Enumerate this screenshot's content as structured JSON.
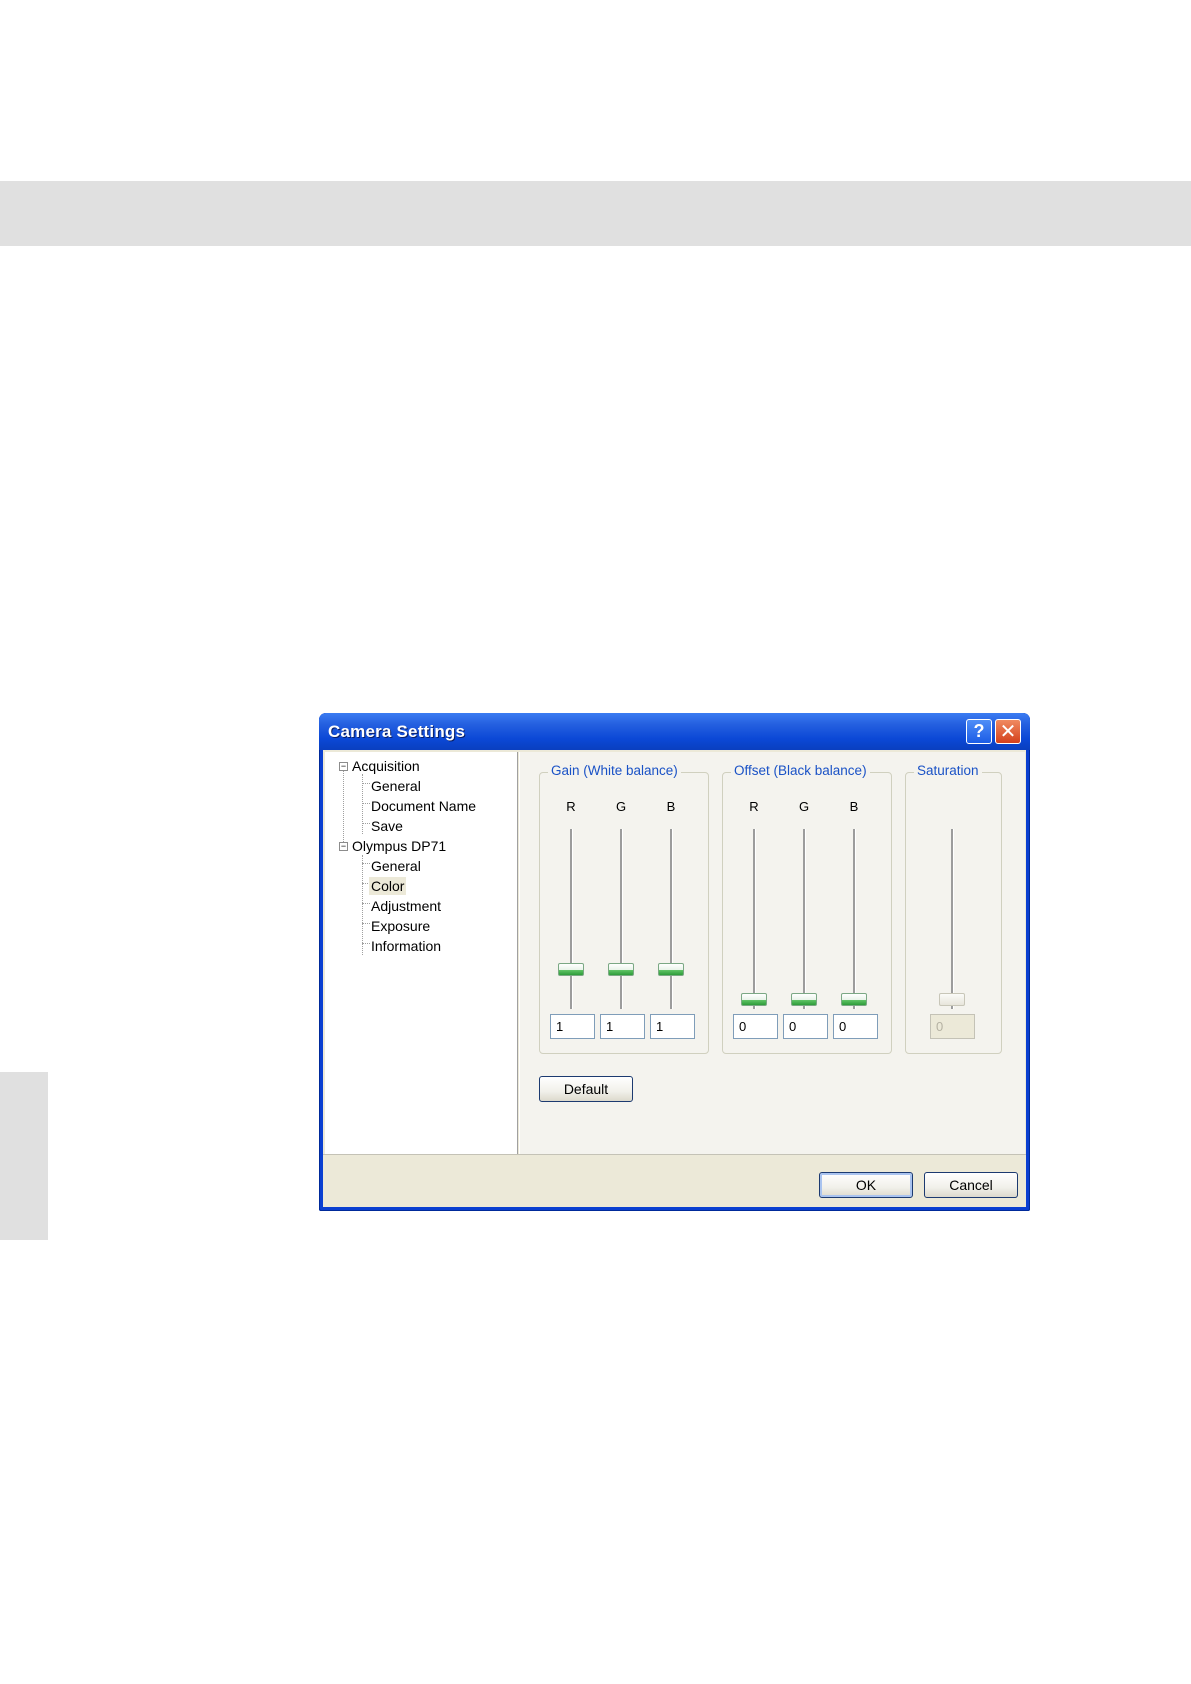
{
  "dialog": {
    "title": "Camera Settings",
    "help_icon": "?",
    "close_icon": "✕"
  },
  "tree": {
    "items": [
      {
        "label": "Acquisition",
        "expander": "⊟"
      },
      {
        "label": "General"
      },
      {
        "label": "Document Name"
      },
      {
        "label": "Save"
      },
      {
        "label": "Olympus DP71",
        "expander": "⊟"
      },
      {
        "label": "General"
      },
      {
        "label": "Color",
        "selected": true
      },
      {
        "label": "Adjustment"
      },
      {
        "label": "Exposure"
      },
      {
        "label": "Information"
      }
    ]
  },
  "gain": {
    "title": "Gain (White balance)",
    "channels": [
      {
        "label": "R",
        "value": "1"
      },
      {
        "label": "G",
        "value": "1"
      },
      {
        "label": "B",
        "value": "1"
      }
    ]
  },
  "offset": {
    "title": "Offset (Black balance)",
    "channels": [
      {
        "label": "R",
        "value": "0"
      },
      {
        "label": "G",
        "value": "0"
      },
      {
        "label": "B",
        "value": "0"
      }
    ]
  },
  "saturation": {
    "title": "Saturation",
    "value": "0",
    "enabled": false
  },
  "buttons": {
    "default_label": "Default",
    "ok_label": "OK",
    "cancel_label": "Cancel"
  },
  "colors": {
    "title_bar": "#0a3fd1",
    "group_label": "#1a52c6",
    "dialog_face": "#ece9d8"
  }
}
